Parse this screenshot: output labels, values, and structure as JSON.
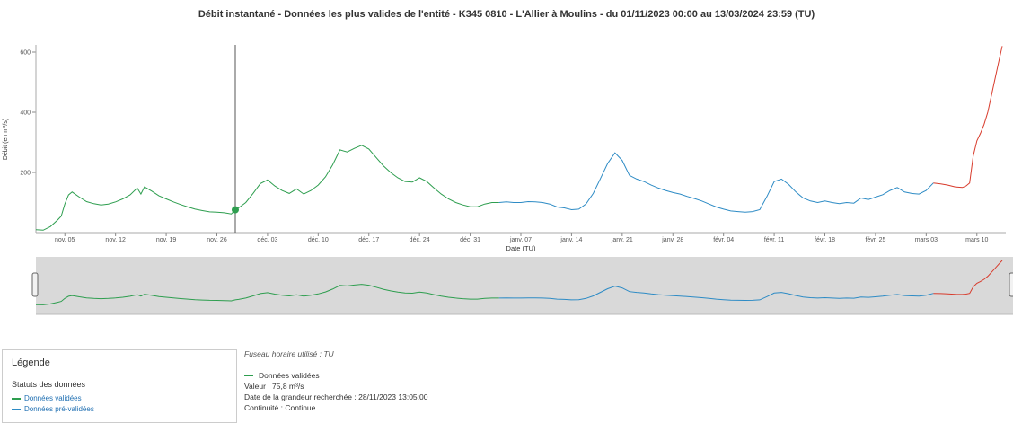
{
  "title": "Débit instantané - Données les plus valides de l'entité - K345 0810 - L'Allier à Moulins - du 01/11/2023 00:00 au 13/03/2024 23:59 (TU)",
  "colors": {
    "validated": "#2e9e4f",
    "prevalidated": "#2d8bc5",
    "gross": "#d83b2c",
    "axis": "#888888",
    "crosshair": "#555555",
    "navigator_bg": "#d9d9d9"
  },
  "chart_data": {
    "type": "line",
    "xlabel": "Date (TU)",
    "ylabel": "Débit (en m³/s)",
    "x_range": [
      "2023-11-01",
      "2024-03-13"
    ],
    "ylim": [
      0,
      620
    ],
    "yticks": [
      200,
      400,
      600
    ],
    "xticks": [
      {
        "date": "2023-11-05",
        "label": "nov. 05"
      },
      {
        "date": "2023-11-12",
        "label": "nov. 12"
      },
      {
        "date": "2023-11-19",
        "label": "nov. 19"
      },
      {
        "date": "2023-11-26",
        "label": "nov. 26"
      },
      {
        "date": "2023-12-03",
        "label": "déc. 03"
      },
      {
        "date": "2023-12-10",
        "label": "déc. 10"
      },
      {
        "date": "2023-12-17",
        "label": "déc. 17"
      },
      {
        "date": "2023-12-24",
        "label": "déc. 24"
      },
      {
        "date": "2023-12-31",
        "label": "déc. 31"
      },
      {
        "date": "2024-01-07",
        "label": "janv. 07"
      },
      {
        "date": "2024-01-14",
        "label": "janv. 14"
      },
      {
        "date": "2024-01-21",
        "label": "janv. 21"
      },
      {
        "date": "2024-01-28",
        "label": "janv. 28"
      },
      {
        "date": "2024-02-04",
        "label": "févr. 04"
      },
      {
        "date": "2024-02-11",
        "label": "févr. 11"
      },
      {
        "date": "2024-02-18",
        "label": "févr. 18"
      },
      {
        "date": "2024-02-25",
        "label": "févr. 25"
      },
      {
        "date": "2024-03-03",
        "label": "mars 03"
      },
      {
        "date": "2024-03-10",
        "label": "mars 10"
      }
    ],
    "series": [
      {
        "name": "Données validées",
        "color": "#2e9e4f",
        "points": [
          [
            "2023-11-01",
            10
          ],
          [
            "2023-11-02",
            8
          ],
          [
            "2023-11-03",
            20
          ],
          [
            "2023-11-04",
            42
          ],
          [
            "2023-11-04T12:00",
            55
          ],
          [
            "2023-11-05",
            95
          ],
          [
            "2023-11-05T12:00",
            125
          ],
          [
            "2023-11-06",
            135
          ],
          [
            "2023-11-07",
            118
          ],
          [
            "2023-11-08",
            103
          ],
          [
            "2023-11-09",
            96
          ],
          [
            "2023-11-10",
            92
          ],
          [
            "2023-11-11",
            95
          ],
          [
            "2023-11-12",
            102
          ],
          [
            "2023-11-13",
            112
          ],
          [
            "2023-11-14",
            125
          ],
          [
            "2023-11-15",
            148
          ],
          [
            "2023-11-15T12:00",
            128
          ],
          [
            "2023-11-16",
            152
          ],
          [
            "2023-11-17",
            138
          ],
          [
            "2023-11-18",
            122
          ],
          [
            "2023-11-19",
            112
          ],
          [
            "2023-11-20",
            102
          ],
          [
            "2023-11-21",
            93
          ],
          [
            "2023-11-22",
            85
          ],
          [
            "2023-11-23",
            78
          ],
          [
            "2023-11-24",
            73
          ],
          [
            "2023-11-25",
            69
          ],
          [
            "2023-11-26",
            68
          ],
          [
            "2023-11-27",
            66
          ],
          [
            "2023-11-28",
            62
          ],
          [
            "2023-11-28T13:05",
            75.8
          ],
          [
            "2023-11-29",
            82
          ],
          [
            "2023-11-30",
            100
          ],
          [
            "2023-12-01",
            130
          ],
          [
            "2023-12-02",
            163
          ],
          [
            "2023-12-03",
            175
          ],
          [
            "2023-12-04",
            155
          ],
          [
            "2023-12-05",
            140
          ],
          [
            "2023-12-06",
            130
          ],
          [
            "2023-12-07",
            145
          ],
          [
            "2023-12-08",
            128
          ],
          [
            "2023-12-09",
            140
          ],
          [
            "2023-12-10",
            158
          ],
          [
            "2023-12-11",
            185
          ],
          [
            "2023-12-12",
            225
          ],
          [
            "2023-12-13",
            275
          ],
          [
            "2023-12-14",
            268
          ],
          [
            "2023-12-15",
            280
          ],
          [
            "2023-12-16",
            290
          ],
          [
            "2023-12-17",
            278
          ],
          [
            "2023-12-18",
            250
          ],
          [
            "2023-12-19",
            222
          ],
          [
            "2023-12-20",
            200
          ],
          [
            "2023-12-21",
            182
          ],
          [
            "2023-12-22",
            170
          ],
          [
            "2023-12-23",
            168
          ],
          [
            "2023-12-24",
            182
          ],
          [
            "2023-12-25",
            170
          ],
          [
            "2023-12-26",
            148
          ],
          [
            "2023-12-27",
            128
          ],
          [
            "2023-12-28",
            112
          ],
          [
            "2023-12-29",
            100
          ],
          [
            "2023-12-30",
            92
          ],
          [
            "2023-12-31",
            86
          ],
          [
            "2024-01-01",
            86
          ],
          [
            "2024-01-02",
            95
          ],
          [
            "2024-01-03",
            100
          ],
          [
            "2024-01-04",
            100
          ]
        ]
      },
      {
        "name": "Données pré-validées",
        "color": "#2d8bc5",
        "points": [
          [
            "2024-01-04",
            100
          ],
          [
            "2024-01-05",
            102
          ],
          [
            "2024-01-06",
            100
          ],
          [
            "2024-01-07",
            100
          ],
          [
            "2024-01-08",
            103
          ],
          [
            "2024-01-09",
            102
          ],
          [
            "2024-01-10",
            100
          ],
          [
            "2024-01-11",
            95
          ],
          [
            "2024-01-12",
            85
          ],
          [
            "2024-01-13",
            82
          ],
          [
            "2024-01-14",
            76
          ],
          [
            "2024-01-15",
            78
          ],
          [
            "2024-01-16",
            95
          ],
          [
            "2024-01-17",
            130
          ],
          [
            "2024-01-18",
            180
          ],
          [
            "2024-01-19",
            230
          ],
          [
            "2024-01-20",
            265
          ],
          [
            "2024-01-21",
            240
          ],
          [
            "2024-01-22",
            190
          ],
          [
            "2024-01-23",
            178
          ],
          [
            "2024-01-24",
            170
          ],
          [
            "2024-01-25",
            158
          ],
          [
            "2024-01-26",
            148
          ],
          [
            "2024-01-27",
            140
          ],
          [
            "2024-01-28",
            133
          ],
          [
            "2024-01-29",
            128
          ],
          [
            "2024-01-30",
            120
          ],
          [
            "2024-01-31",
            113
          ],
          [
            "2024-02-01",
            105
          ],
          [
            "2024-02-02",
            95
          ],
          [
            "2024-02-03",
            85
          ],
          [
            "2024-02-04",
            78
          ],
          [
            "2024-02-05",
            72
          ],
          [
            "2024-02-06",
            70
          ],
          [
            "2024-02-07",
            68
          ],
          [
            "2024-02-08",
            70
          ],
          [
            "2024-02-09",
            76
          ],
          [
            "2024-02-10",
            120
          ],
          [
            "2024-02-11",
            170
          ],
          [
            "2024-02-12",
            178
          ],
          [
            "2024-02-13",
            160
          ],
          [
            "2024-02-14",
            135
          ],
          [
            "2024-02-15",
            115
          ],
          [
            "2024-02-16",
            105
          ],
          [
            "2024-02-17",
            100
          ],
          [
            "2024-02-18",
            105
          ],
          [
            "2024-02-19",
            100
          ],
          [
            "2024-02-20",
            96
          ],
          [
            "2024-02-21",
            100
          ],
          [
            "2024-02-22",
            98
          ],
          [
            "2024-02-23",
            115
          ],
          [
            "2024-02-24",
            110
          ],
          [
            "2024-02-25",
            118
          ],
          [
            "2024-02-26",
            126
          ],
          [
            "2024-02-27",
            140
          ],
          [
            "2024-02-28",
            150
          ],
          [
            "2024-02-29",
            135
          ],
          [
            "2024-03-01",
            130
          ],
          [
            "2024-03-02",
            128
          ],
          [
            "2024-03-03",
            140
          ],
          [
            "2024-03-04",
            165
          ]
        ]
      },
      {
        "name": "",
        "color": "#d83b2c",
        "points": [
          [
            "2024-03-04",
            165
          ],
          [
            "2024-03-05",
            162
          ],
          [
            "2024-03-06",
            158
          ],
          [
            "2024-03-07",
            152
          ],
          [
            "2024-03-08",
            150
          ],
          [
            "2024-03-08T12:00",
            155
          ],
          [
            "2024-03-09",
            165
          ],
          [
            "2024-03-09T12:00",
            255
          ],
          [
            "2024-03-10",
            305
          ],
          [
            "2024-03-10T12:00",
            330
          ],
          [
            "2024-03-11",
            360
          ],
          [
            "2024-03-11T12:00",
            400
          ],
          [
            "2024-03-12",
            455
          ],
          [
            "2024-03-12T12:00",
            510
          ],
          [
            "2024-03-13",
            565
          ],
          [
            "2024-03-13T12:00",
            620
          ]
        ]
      }
    ],
    "highlight": {
      "date": "2023-11-28T13:05",
      "value": 75.8
    }
  },
  "legend": {
    "title": "Légende",
    "subtitle": "Statuts des données",
    "items": [
      {
        "label": "Données validées",
        "color": "#2e9e4f"
      },
      {
        "label": "Données pré-validées",
        "color": "#2d8bc5"
      }
    ]
  },
  "tooltip": {
    "timezone_note": "Fuseau horaire utilisé : TU",
    "series_label": "Données validées",
    "series_color": "#2e9e4f",
    "value": "Valeur : 75,8 m³/s",
    "date": "Date de la grandeur recherchée : 28/11/2023 13:05:00",
    "continuity": "Continuité : Continue"
  }
}
